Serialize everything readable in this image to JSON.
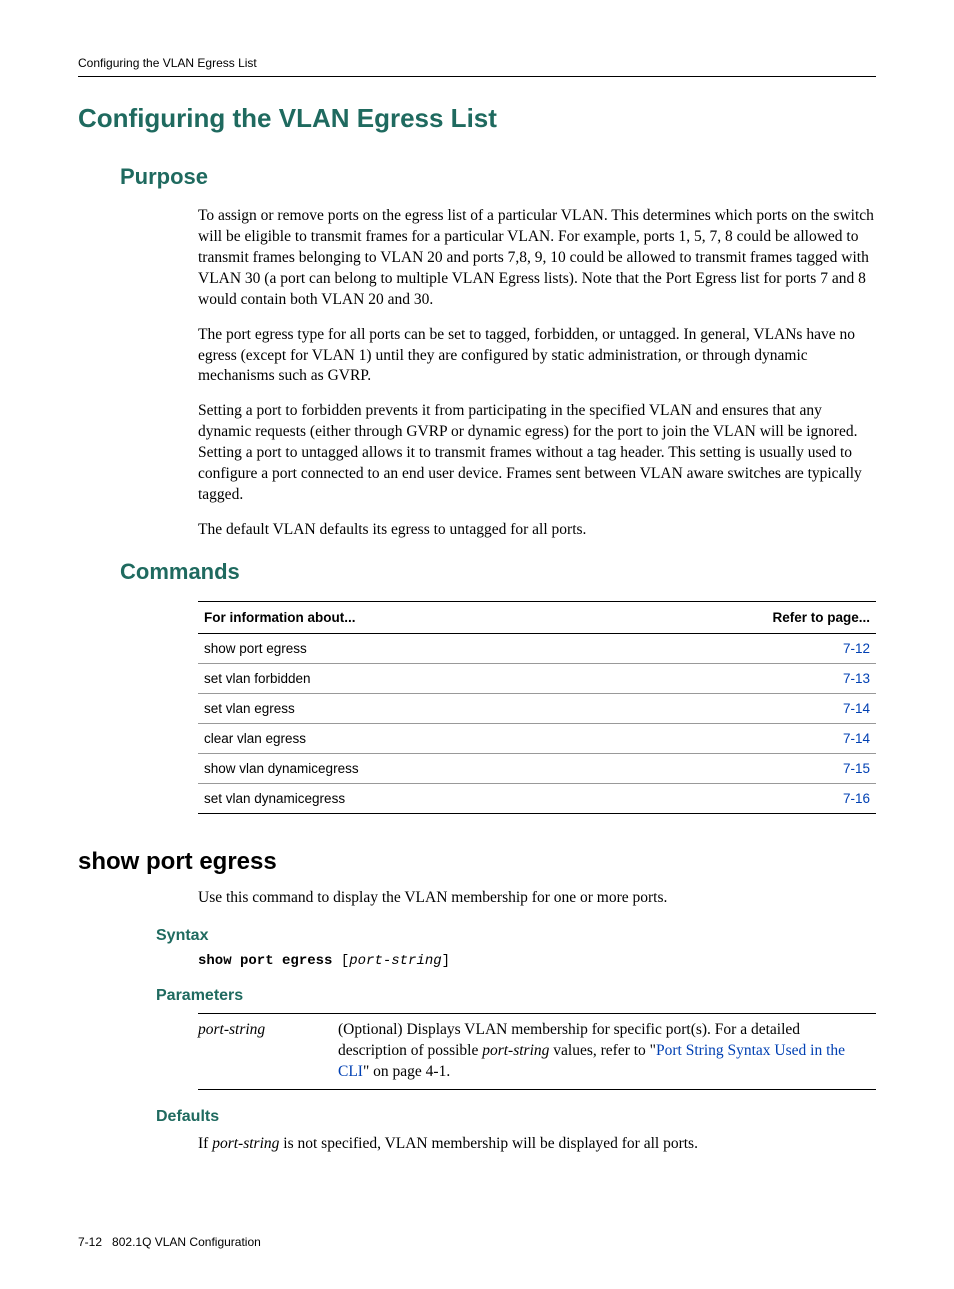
{
  "running_head": "Configuring the VLAN Egress List",
  "h1": "Configuring the VLAN Egress List",
  "purpose": {
    "heading": "Purpose",
    "p1": "To assign or remove ports on the egress list of a particular VLAN. This determines which ports on the switch will be eligible to transmit frames for a particular VLAN. For example, ports 1, 5, 7, 8 could be allowed to transmit frames belonging to VLAN 20 and ports 7,8, 9, 10 could be allowed to transmit frames tagged with VLAN 30 (a port can belong to multiple VLAN Egress lists). Note that the Port Egress list for ports 7 and 8 would contain both VLAN 20 and 30.",
    "p2": "The port egress type for all ports can be set to tagged, forbidden, or untagged. In general, VLANs have no egress (except for VLAN 1) until they are configured by static administration, or through dynamic mechanisms such as GVRP.",
    "p3": "Setting a port to forbidden prevents it from participating in the specified VLAN and ensures that any dynamic requests (either through GVRP or dynamic egress) for the port to join the VLAN will be ignored. Setting a port to untagged allows it to transmit frames without a tag header. This setting is usually used to configure a port connected to an end user device. Frames sent between VLAN aware switches are typically tagged.",
    "p4": "The default VLAN defaults its egress to untagged for all ports."
  },
  "commands": {
    "heading": "Commands",
    "col1": "For information about...",
    "col2": "Refer to page...",
    "rows": [
      {
        "name": "show port egress",
        "page": "7-12"
      },
      {
        "name": "set vlan forbidden",
        "page": "7-13"
      },
      {
        "name": "set vlan egress",
        "page": "7-14"
      },
      {
        "name": "clear vlan egress",
        "page": "7-14"
      },
      {
        "name": "show vlan dynamicegress",
        "page": "7-15"
      },
      {
        "name": "set vlan dynamicegress",
        "page": "7-16"
      }
    ]
  },
  "command_detail": {
    "heading": "show port egress",
    "desc": "Use this command to display the VLAN membership for one or more ports.",
    "syntax": {
      "heading": "Syntax",
      "kw": "show port egress",
      "bracket_open": " [",
      "arg": "port-string",
      "bracket_close": "]"
    },
    "parameters": {
      "heading": "Parameters",
      "row": {
        "name": "port-string",
        "desc_pre": "(Optional) Displays VLAN membership for specific port(s). For a detailed description of possible ",
        "desc_em": "port-string",
        "desc_mid": " values, refer to \"",
        "link": "Port String Syntax Used in the CLI",
        "desc_post": "\" on page 4-1."
      }
    },
    "defaults": {
      "heading": "Defaults",
      "pre": "If ",
      "em": "port-string",
      "post": " is not specified, VLAN membership will be displayed for all ports."
    }
  },
  "footer": {
    "page": "7-12",
    "title": "802.1Q VLAN Configuration"
  }
}
